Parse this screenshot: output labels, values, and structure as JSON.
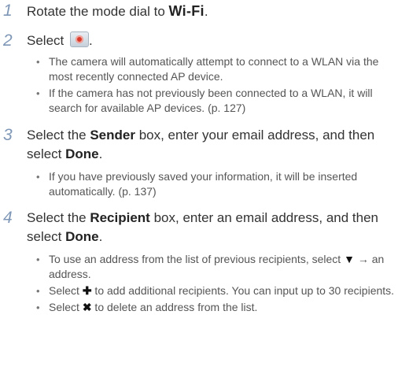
{
  "steps": [
    {
      "number": "1",
      "pre": "Rotate the mode dial to ",
      "bold": "Wi-Fi",
      "post": "."
    },
    {
      "number": "2",
      "pre": "Select ",
      "icon": "share-email-icon",
      "post": ".",
      "bullets": [
        "The camera will automatically attempt to connect to a WLAN via the most recently connected AP device.",
        "If the camera has not previously been connected to a WLAN, it will search for available AP devices. (p. 127)"
      ]
    },
    {
      "number": "3",
      "pre": "Select the ",
      "bold1": "Sender",
      "mid": " box, enter your email address, and then select ",
      "bold2": "Done",
      "post": ".",
      "bullets": [
        "If you have previously saved your information, it will be inserted automatically. (p. 137)"
      ]
    },
    {
      "number": "4",
      "pre": "Select the ",
      "bold1": "Recipient",
      "mid": " box, enter an email address, and then select ",
      "bold2": "Done",
      "post": ".",
      "bullets": [
        {
          "pre": "To use an address from the list of previous recipients, select ",
          "glyph": "▼",
          "post": " → an address."
        },
        {
          "pre": "Select ",
          "glyph": "✚",
          "post": " to add additional recipients. You can input up to 30 recipients."
        },
        {
          "pre": "Select ",
          "glyph": "✖",
          "post": " to delete an address from the list."
        }
      ]
    }
  ],
  "icons": {
    "share": "share-email-icon",
    "down": "down-triangle-icon",
    "plus": "plus-icon",
    "delete": "x-icon"
  }
}
